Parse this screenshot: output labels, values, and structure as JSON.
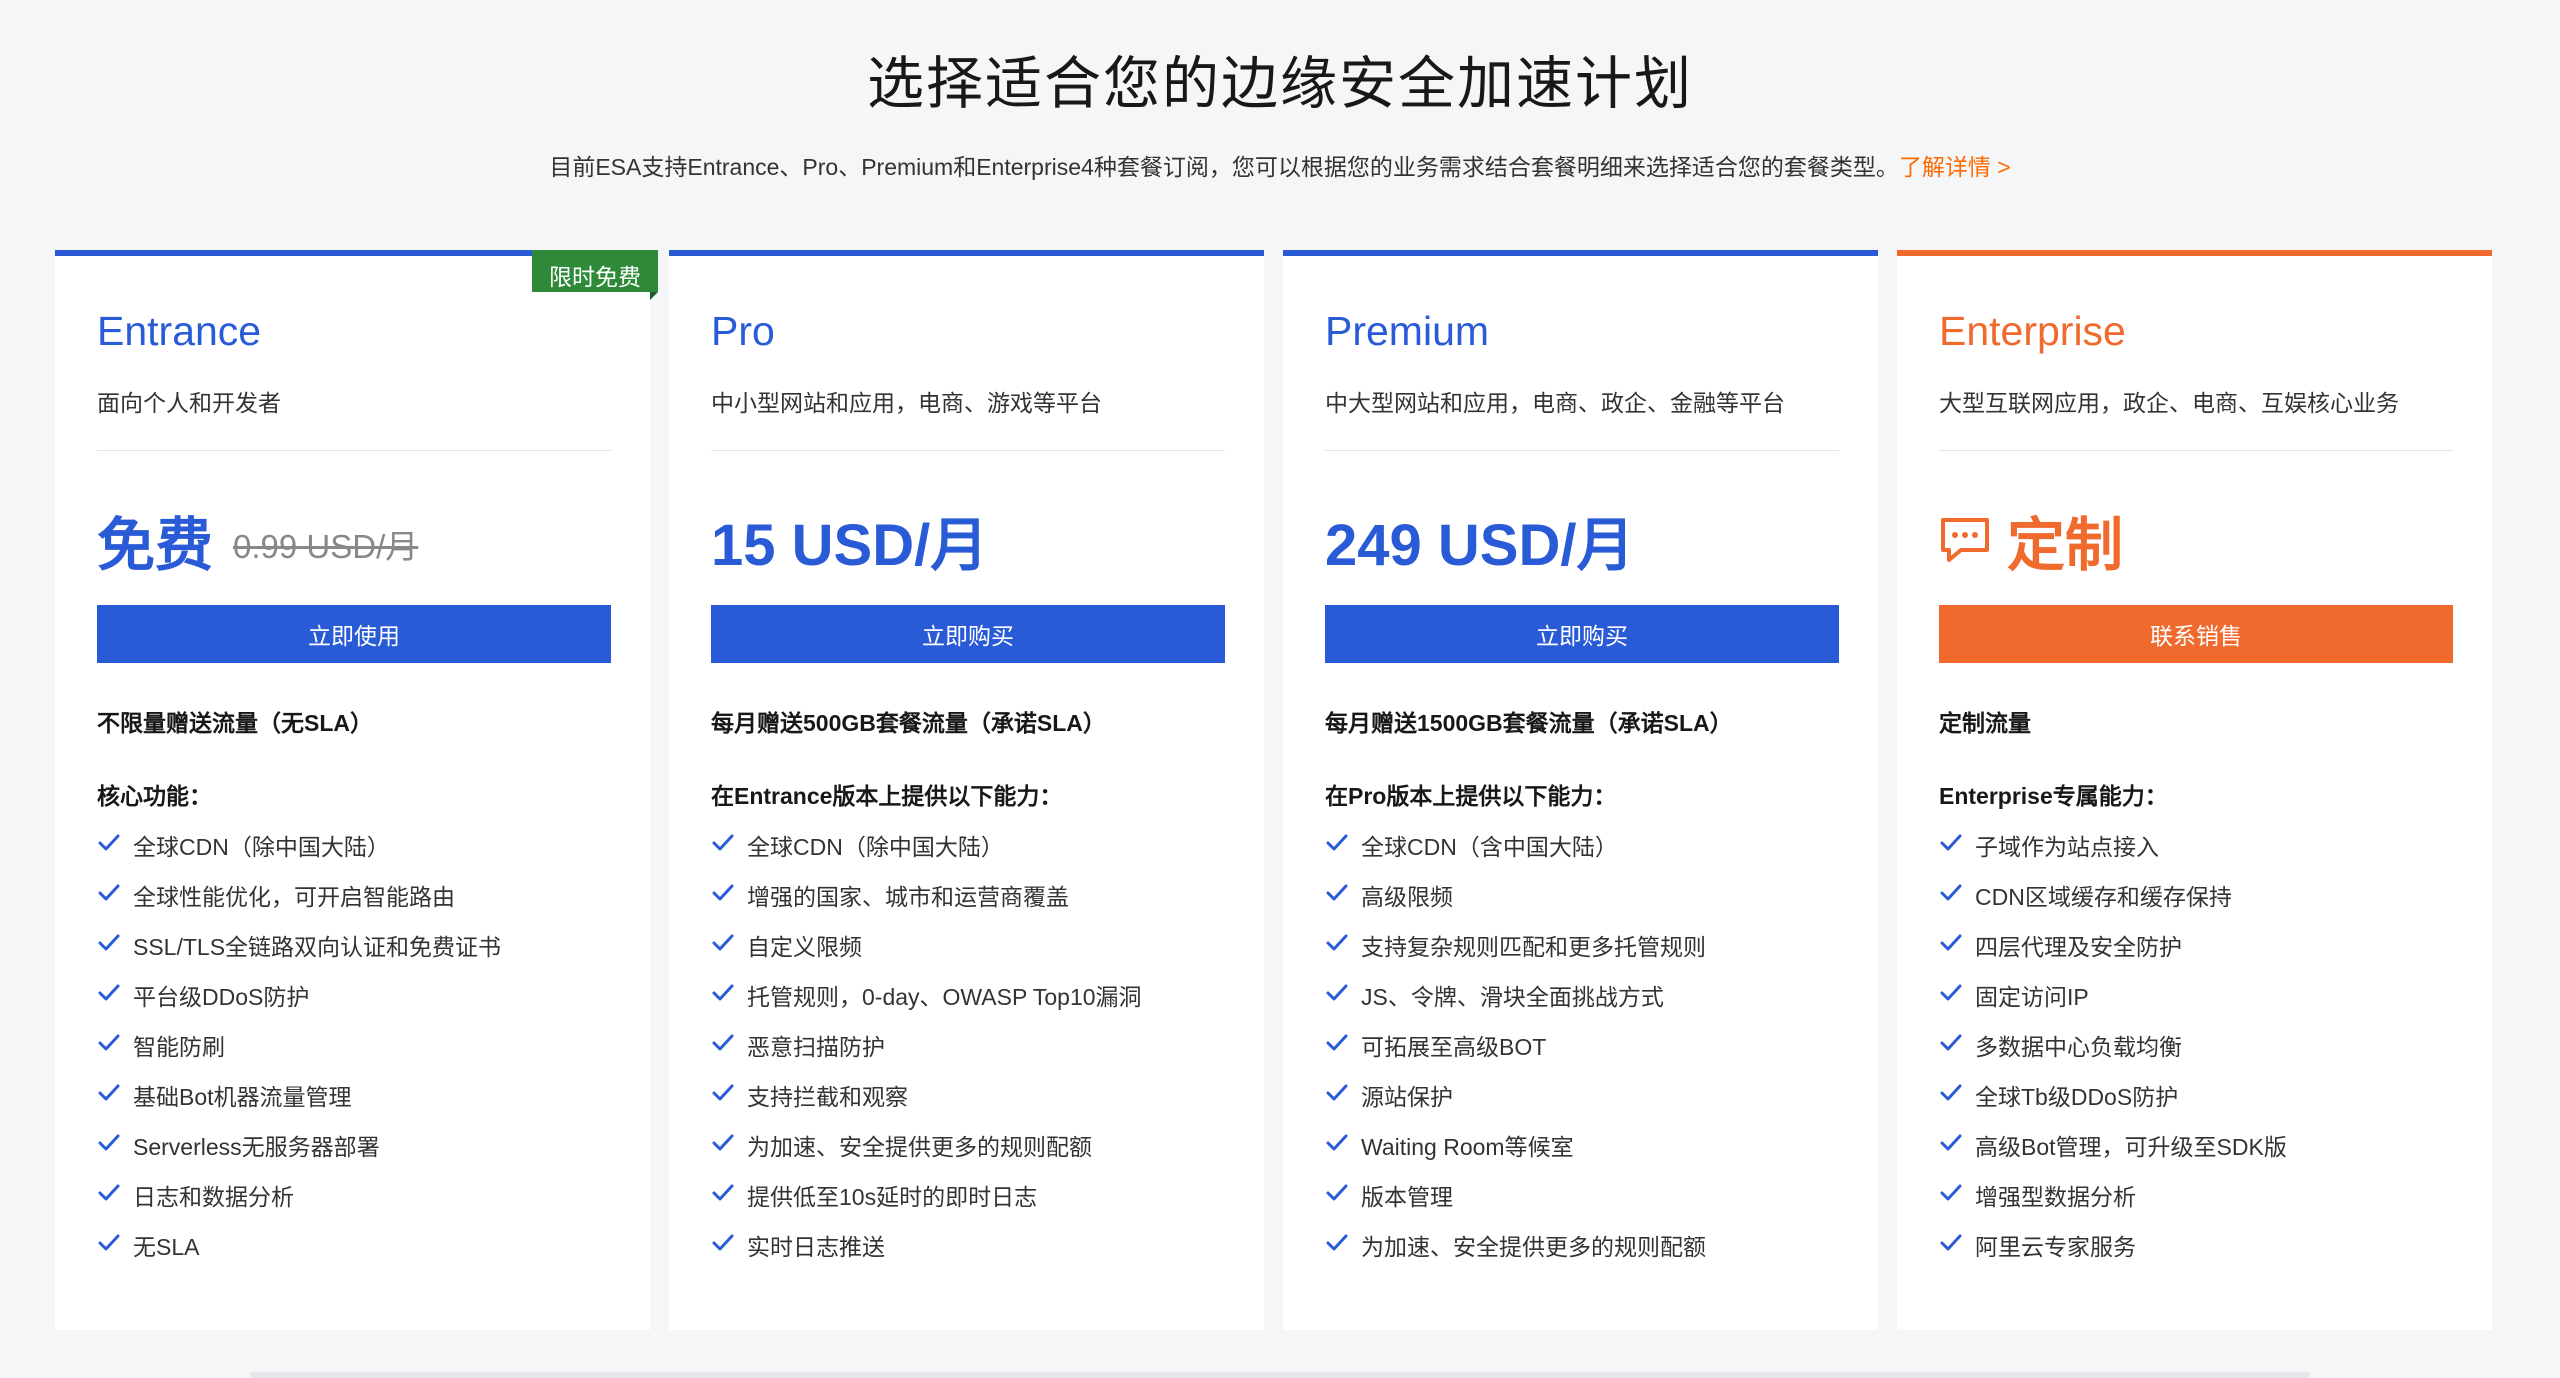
{
  "page": {
    "title": "选择适合您的边缘安全加速计划",
    "subtitle": "目前ESA支持Entrance、Pro、Premium和Enterprise4种套餐订阅，您可以根据您的业务需求结合套餐明细来选择适合您的套餐类型。",
    "details_link": "了解详情 >"
  },
  "colors": {
    "blue": "#2a5bd7",
    "orange": "#f06a2d",
    "green_badge": "#2e8a38"
  },
  "plans": [
    {
      "name": "Entrance",
      "desc": "面向个人和开发者",
      "badge": "限时免费",
      "price": "免费",
      "orig_price": "0.99 USD/月",
      "cta": "立即使用",
      "traffic": "不限量赠送流量（无SLA）",
      "features_title": "核心功能：",
      "features": [
        "全球CDN（除中国大陆）",
        "全球性能优化，可开启智能路由",
        "SSL/TLS全链路双向认证和免费证书",
        "平台级DDoS防护",
        "智能防刷",
        "基础Bot机器流量管理",
        "Serverless无服务器部署",
        "日志和数据分析",
        "无SLA"
      ]
    },
    {
      "name": "Pro",
      "desc": "中小型网站和应用，电商、游戏等平台",
      "price": "15 USD/月",
      "cta": "立即购买",
      "traffic": "每月赠送500GB套餐流量（承诺SLA）",
      "features_title": "在Entrance版本上提供以下能力：",
      "features": [
        "全球CDN（除中国大陆）",
        "增强的国家、城市和运营商覆盖",
        "自定义限频",
        "托管规则，0-day、OWASP Top10漏洞",
        "恶意扫描防护",
        "支持拦截和观察",
        "为加速、安全提供更多的规则配额",
        "提供低至10s延时的即时日志",
        "实时日志推送"
      ]
    },
    {
      "name": "Premium",
      "desc": "中大型网站和应用，电商、政企、金融等平台",
      "price": "249 USD/月",
      "cta": "立即购买",
      "traffic": "每月赠送1500GB套餐流量（承诺SLA）",
      "features_title": "在Pro版本上提供以下能力：",
      "features": [
        "全球CDN（含中国大陆）",
        "高级限频",
        "支持复杂规则匹配和更多托管规则",
        "JS、令牌、滑块全面挑战方式",
        "可拓展至高级BOT",
        "源站保护",
        "Waiting Room等候室",
        "版本管理",
        "为加速、安全提供更多的规则配额"
      ]
    },
    {
      "name": "Enterprise",
      "desc": "大型互联网应用，政企、电商、互娱核心业务",
      "price": "定制",
      "price_icon": "chat-bubble-icon",
      "cta": "联系销售",
      "traffic": "定制流量",
      "features_title": "Enterprise专属能力：",
      "features": [
        "子域作为站点接入",
        "CDN区域缓存和缓存保持",
        "四层代理及安全防护",
        "固定访问IP",
        "多数据中心负载均衡",
        "全球Tb级DDoS防护",
        "高级Bot管理，可升级至SDK版",
        "增强型数据分析",
        "阿里云专家服务"
      ]
    }
  ]
}
